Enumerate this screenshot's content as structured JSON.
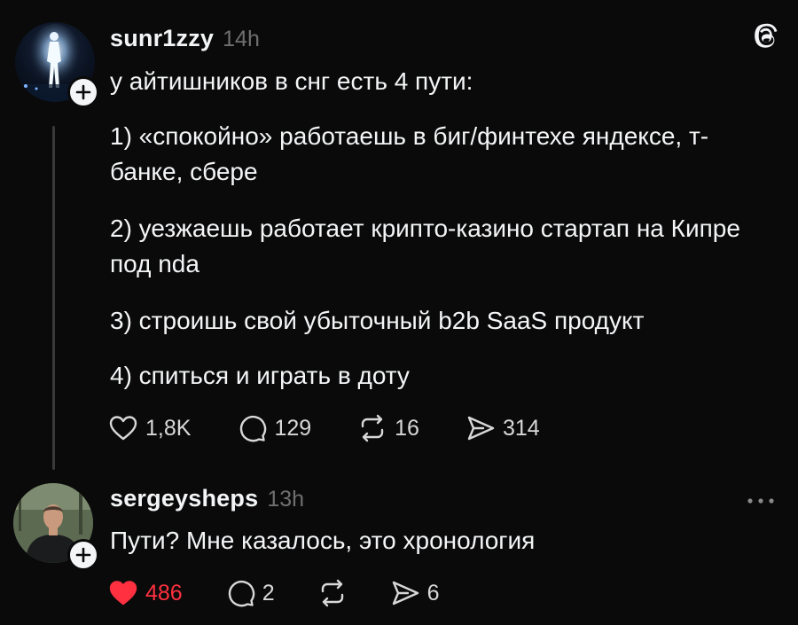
{
  "post": {
    "username": "sunr1zzy",
    "time": "14h",
    "paragraphs": [
      "у айтишников в снг есть 4 пути:",
      "1) «спокойно» работаешь в биг/финтехе яндексе, т-банке, сбере",
      "2) уезжаешь работает крипто-казино стартап на Кипре под nda",
      "3) строишь свой убыточный b2b SaaS продукт",
      "4) спиться и играть в доту"
    ],
    "stats": {
      "likes": "1,8K",
      "replies": "129",
      "reposts": "16",
      "shares": "314"
    }
  },
  "reply": {
    "username": "sergeysheps",
    "time": "13h",
    "text": "Пути? Мне казалось, это хронология",
    "stats": {
      "likes": "486",
      "replies": "2",
      "shares": "6"
    },
    "liked": true
  },
  "colors": {
    "background": "#0a0a0a",
    "text": "#f3f5f7",
    "muted": "#6f6f6f",
    "like": "#ff3040"
  },
  "icons": [
    "threads-logo-icon",
    "follow-plus-icon",
    "heart-icon",
    "comment-icon",
    "repost-icon",
    "share-icon",
    "more-icon"
  ]
}
